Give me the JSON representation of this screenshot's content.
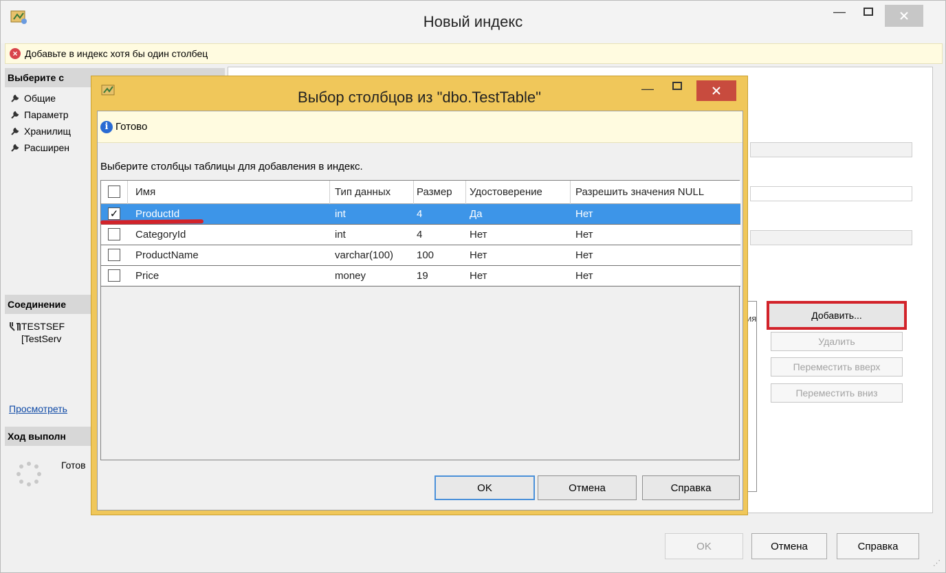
{
  "main_window": {
    "title": "Новый индекс",
    "error_message": "Добавьте в индекс хотя бы один столбец",
    "left_pane": {
      "select_page_header": "Выберите с",
      "nav_items": [
        "Общие",
        "Параметр",
        "Хранилищ",
        "Расширен"
      ],
      "connection_header": "Соединение",
      "connection_server": "TESTSEF",
      "connection_detail": "[TestServ",
      "view_link": "Просмотреть",
      "progress_header": "Ход выполн",
      "progress_status": "Готов"
    },
    "right_pane": {
      "column_header_fragment": "ия",
      "buttons": {
        "add": "Добавить...",
        "remove": "Удалить",
        "move_up": "Переместить вверх",
        "move_down": "Переместить вниз"
      }
    },
    "footer_buttons": {
      "ok": "OK",
      "cancel": "Отмена",
      "help": "Справка"
    }
  },
  "dialog": {
    "title": "Выбор столбцов из \"dbo.TestTable\"",
    "status": "Готово",
    "instruction": "Выберите столбцы таблицы для добавления в индекс.",
    "columns": [
      "Имя",
      "Тип данных",
      "Размер",
      "Удостоверение",
      "Разрешить значения NULL"
    ],
    "rows": [
      {
        "checked": true,
        "name": "ProductId",
        "type": "int",
        "size": "4",
        "identity": "Да",
        "nullable": "Нет"
      },
      {
        "checked": false,
        "name": "CategoryId",
        "type": "int",
        "size": "4",
        "identity": "Нет",
        "nullable": "Нет"
      },
      {
        "checked": false,
        "name": "ProductName",
        "type": "varchar(100)",
        "size": "100",
        "identity": "Нет",
        "nullable": "Нет"
      },
      {
        "checked": false,
        "name": "Price",
        "type": "money",
        "size": "19",
        "identity": "Нет",
        "nullable": "Нет"
      }
    ],
    "buttons": {
      "ok": "OK",
      "cancel": "Отмена",
      "help": "Справка"
    }
  },
  "colors": {
    "selection": "#3d95e8",
    "dialog_frame": "#f0c75a",
    "highlight_red": "#d2232a",
    "info_bar": "#fffbe0"
  },
  "icons": {
    "app": "app-icon",
    "error": "error-icon",
    "info": "info-icon",
    "nav": "wrench-icon",
    "connection": "server-icon",
    "progress": "spinner-icon"
  }
}
